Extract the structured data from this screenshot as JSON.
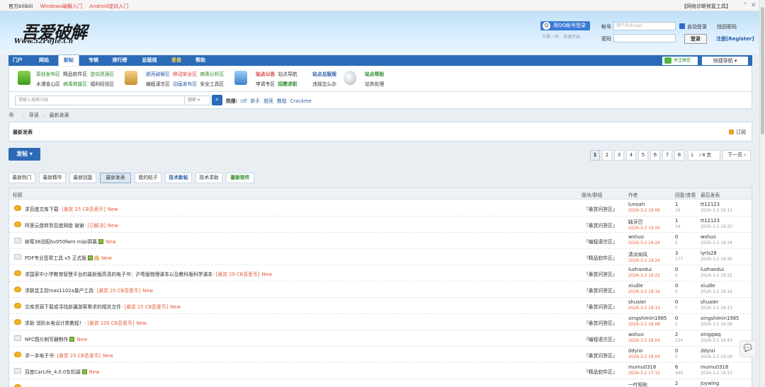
{
  "topbar": {
    "links": [
      "官方bilibili",
      "Windows破解入门",
      "Android逆向入门"
    ],
    "right": "【网络诊断修复工具】"
  },
  "header": {
    "logo_main": "吾爱破解",
    "logo_sub": "Www.52PoJie.Cn",
    "qq_login": "用QQ帐号登录",
    "qq_tip": "只需一步，快速开始",
    "account_label": "帐号",
    "account_placeholder": "用户名/Email",
    "auto_login": "自动登录",
    "forgot": "找回密码",
    "password_label": "密码",
    "login_button": "登录",
    "register": "注册[Register]"
  },
  "nav": {
    "items": [
      "门户",
      "网站",
      "新帖",
      "专辑",
      "排行榜",
      "总版规",
      "爱盘",
      "帮助"
    ],
    "wechat": "关注微信",
    "quick": "快捷导航 ▾"
  },
  "subnav": {
    "g1_r1": [
      "原创发布区",
      "精品软件区",
      "逆向资源区"
    ],
    "g1_r2": [
      "水漫金山区",
      "病毒救援区",
      "福利经验区"
    ],
    "g2_r1": [
      "脱壳破解区",
      "移动安全区",
      "病毒分析区"
    ],
    "g2_r2": [
      "编程语言区",
      "动画发布区",
      "安全工具区"
    ],
    "g3_r1": [
      "站点公告",
      "站点导航"
    ],
    "g3_r2": [
      "申请专区",
      "招聘求职"
    ],
    "g4_r1": [
      "站点总版规"
    ],
    "g4_r2": [
      "违规怎么办"
    ],
    "g5_r1": [
      "站点帮助"
    ],
    "g5_r2": [
      "站务处理"
    ]
  },
  "search": {
    "placeholder": "请输入搜索内容",
    "type": "搜索",
    "hot_label": "热搜:",
    "hot_terms": [
      "ctf",
      "新手",
      "脱壳",
      "教程",
      "Crackme"
    ]
  },
  "breadcrumb": [
    "导读",
    "最新发表"
  ],
  "panel": {
    "title": "最新发表",
    "subscribe": "订阅"
  },
  "post_button": "发帖 ▾",
  "pager": {
    "pages": [
      "1",
      "2",
      "3",
      "4",
      "5",
      "6",
      "7",
      "8"
    ],
    "current": "1",
    "input_value": "1",
    "total": "/ 8 页",
    "next": "下一页 ›"
  },
  "tabs": [
    "最新热门",
    "最新精华",
    "最新回复",
    "最新发表",
    "我的帖子",
    "技术新帖",
    "技术求助",
    "最新软件"
  ],
  "list_header": {
    "title": "标题",
    "forum": "版块/群组",
    "author": "作者",
    "replies": "回复/查看",
    "last": "最后发表"
  },
  "threads": [
    {
      "title": "求百度文库下载",
      "reward": "- [悬赏 25 CB吾爱币]",
      "forum": "『悬赏问答区』",
      "author": "lunoah",
      "date": "2026-3-2 19:06",
      "replies": "1",
      "views": "16",
      "last_user": "tt12123",
      "last_date": "2026-3-2 19:13",
      "icon": "y"
    },
    {
      "title": "阿里云盘转到百度网盘 谢谢",
      "reward": "- [已解决]",
      "forum": "『悬赏问答区』",
      "author": "缺牙巴",
      "date": "2026-3-2 19:00",
      "replies": "1",
      "views": "14",
      "last_user": "tt12123",
      "last_date": "2026-3-2 19:20",
      "icon": "y"
    },
    {
      "title": "树莓38适配bv050fwm mipi屏幕",
      "reward": "",
      "forum": "『编程语言区』",
      "author": "wshuo",
      "date": "2026-3-2 18:24",
      "replies": "0",
      "views": "0",
      "last_user": "wshuo",
      "last_date": "2026-3-2 18:24",
      "icon": "n",
      "att": true
    },
    {
      "title": "PDF专业签章工具 v5 正式版",
      "reward": "",
      "forum": "『精品软件区』",
      "author": "清淡如风",
      "date": "2026-3-2 18:24",
      "replies": "3",
      "views": "177",
      "last_user": "lyrls28",
      "last_date": "2026-3-2 18:49",
      "icon": "n",
      "att": true,
      "hand": true
    },
    {
      "title": "求国家中小学教育智慧平台的最新版高清的电子书：沪粤版物理课本以及教科版科学课本",
      "reward": "- [悬赏 29 CB吾爱币]",
      "forum": "『悬赏问答区』",
      "author": "luzhandui",
      "date": "2026-3-2 18:22",
      "replies": "0",
      "views": "0",
      "last_user": "luzhandui",
      "last_date": "2026-3-2 18:22",
      "icon": "y"
    },
    {
      "title": "求联芸主控mas1102a量产工具",
      "reward": "- [悬赏 25 CB吾爱币]",
      "forum": "『悬赏问答区』",
      "author": "xiudle",
      "date": "2026-3-2 18:16",
      "replies": "0",
      "views": "0",
      "last_user": "xiudle",
      "last_date": "2026-3-2 18:16",
      "icon": "y"
    },
    {
      "title": "文库资源下载或寻找新疆游客需求的相关文件",
      "reward": "- [悬赏 25 CB吾爱币]",
      "forum": "『悬赏问答区』",
      "author": "shuaier",
      "date": "2026-3-2 18:13",
      "replies": "0",
      "views": "0",
      "last_user": "shuaier",
      "last_date": "2026-3-2 18:13",
      "icon": "y"
    },
    {
      "title": "求助 消防水电设计类教程！",
      "reward": "- [悬赏 100 CB吾爱币]",
      "forum": "『悬赏问答区』",
      "author": "xingshimin1985",
      "date": "2026-3-2 18:08",
      "replies": "0",
      "views": "0",
      "last_user": "xingshimin1985",
      "last_date": "2026-3-2 18:08",
      "icon": "y"
    },
    {
      "title": "NFC图片刷写器制作",
      "reward": "",
      "forum": "『编程语言区』",
      "author": "wshuo",
      "date": "2026-3-2 18:04",
      "replies": "2",
      "views": "134",
      "last_user": "xingqwq",
      "last_date": "2026-3-2 18:43",
      "icon": "n",
      "att": true
    },
    {
      "title": "求一本电子书",
      "reward": "- [悬赏 25 CB吾爱币]",
      "forum": "『悬赏问答区』",
      "author": "ddyixi",
      "date": "2026-3-2 18:04",
      "replies": "0",
      "views": "0",
      "last_user": "ddyixi",
      "last_date": "2026-3-2 18:04",
      "icon": "y"
    },
    {
      "title": "百度CarLife_4.0.0车机端",
      "reward": "",
      "forum": "『精品软件区』",
      "author": "mumu0318",
      "date": "2026-3-2 17:12",
      "replies": "6",
      "views": "440",
      "last_user": "mumu0318",
      "last_date": "2026-3-2 19:23",
      "icon": "n",
      "att": true
    },
    {
      "title": "",
      "reward": "",
      "forum": "",
      "author": "一叶知秋",
      "date": "",
      "replies": "2",
      "views": "",
      "last_user": "joywing",
      "last_date": "",
      "icon": "y"
    }
  ],
  "new_label": "New",
  "colors": {
    "nav_blue": "#2b6bb8",
    "reward": "#e5603b",
    "link_blue": "#2a5ca8",
    "green": "#2a8a2a"
  }
}
